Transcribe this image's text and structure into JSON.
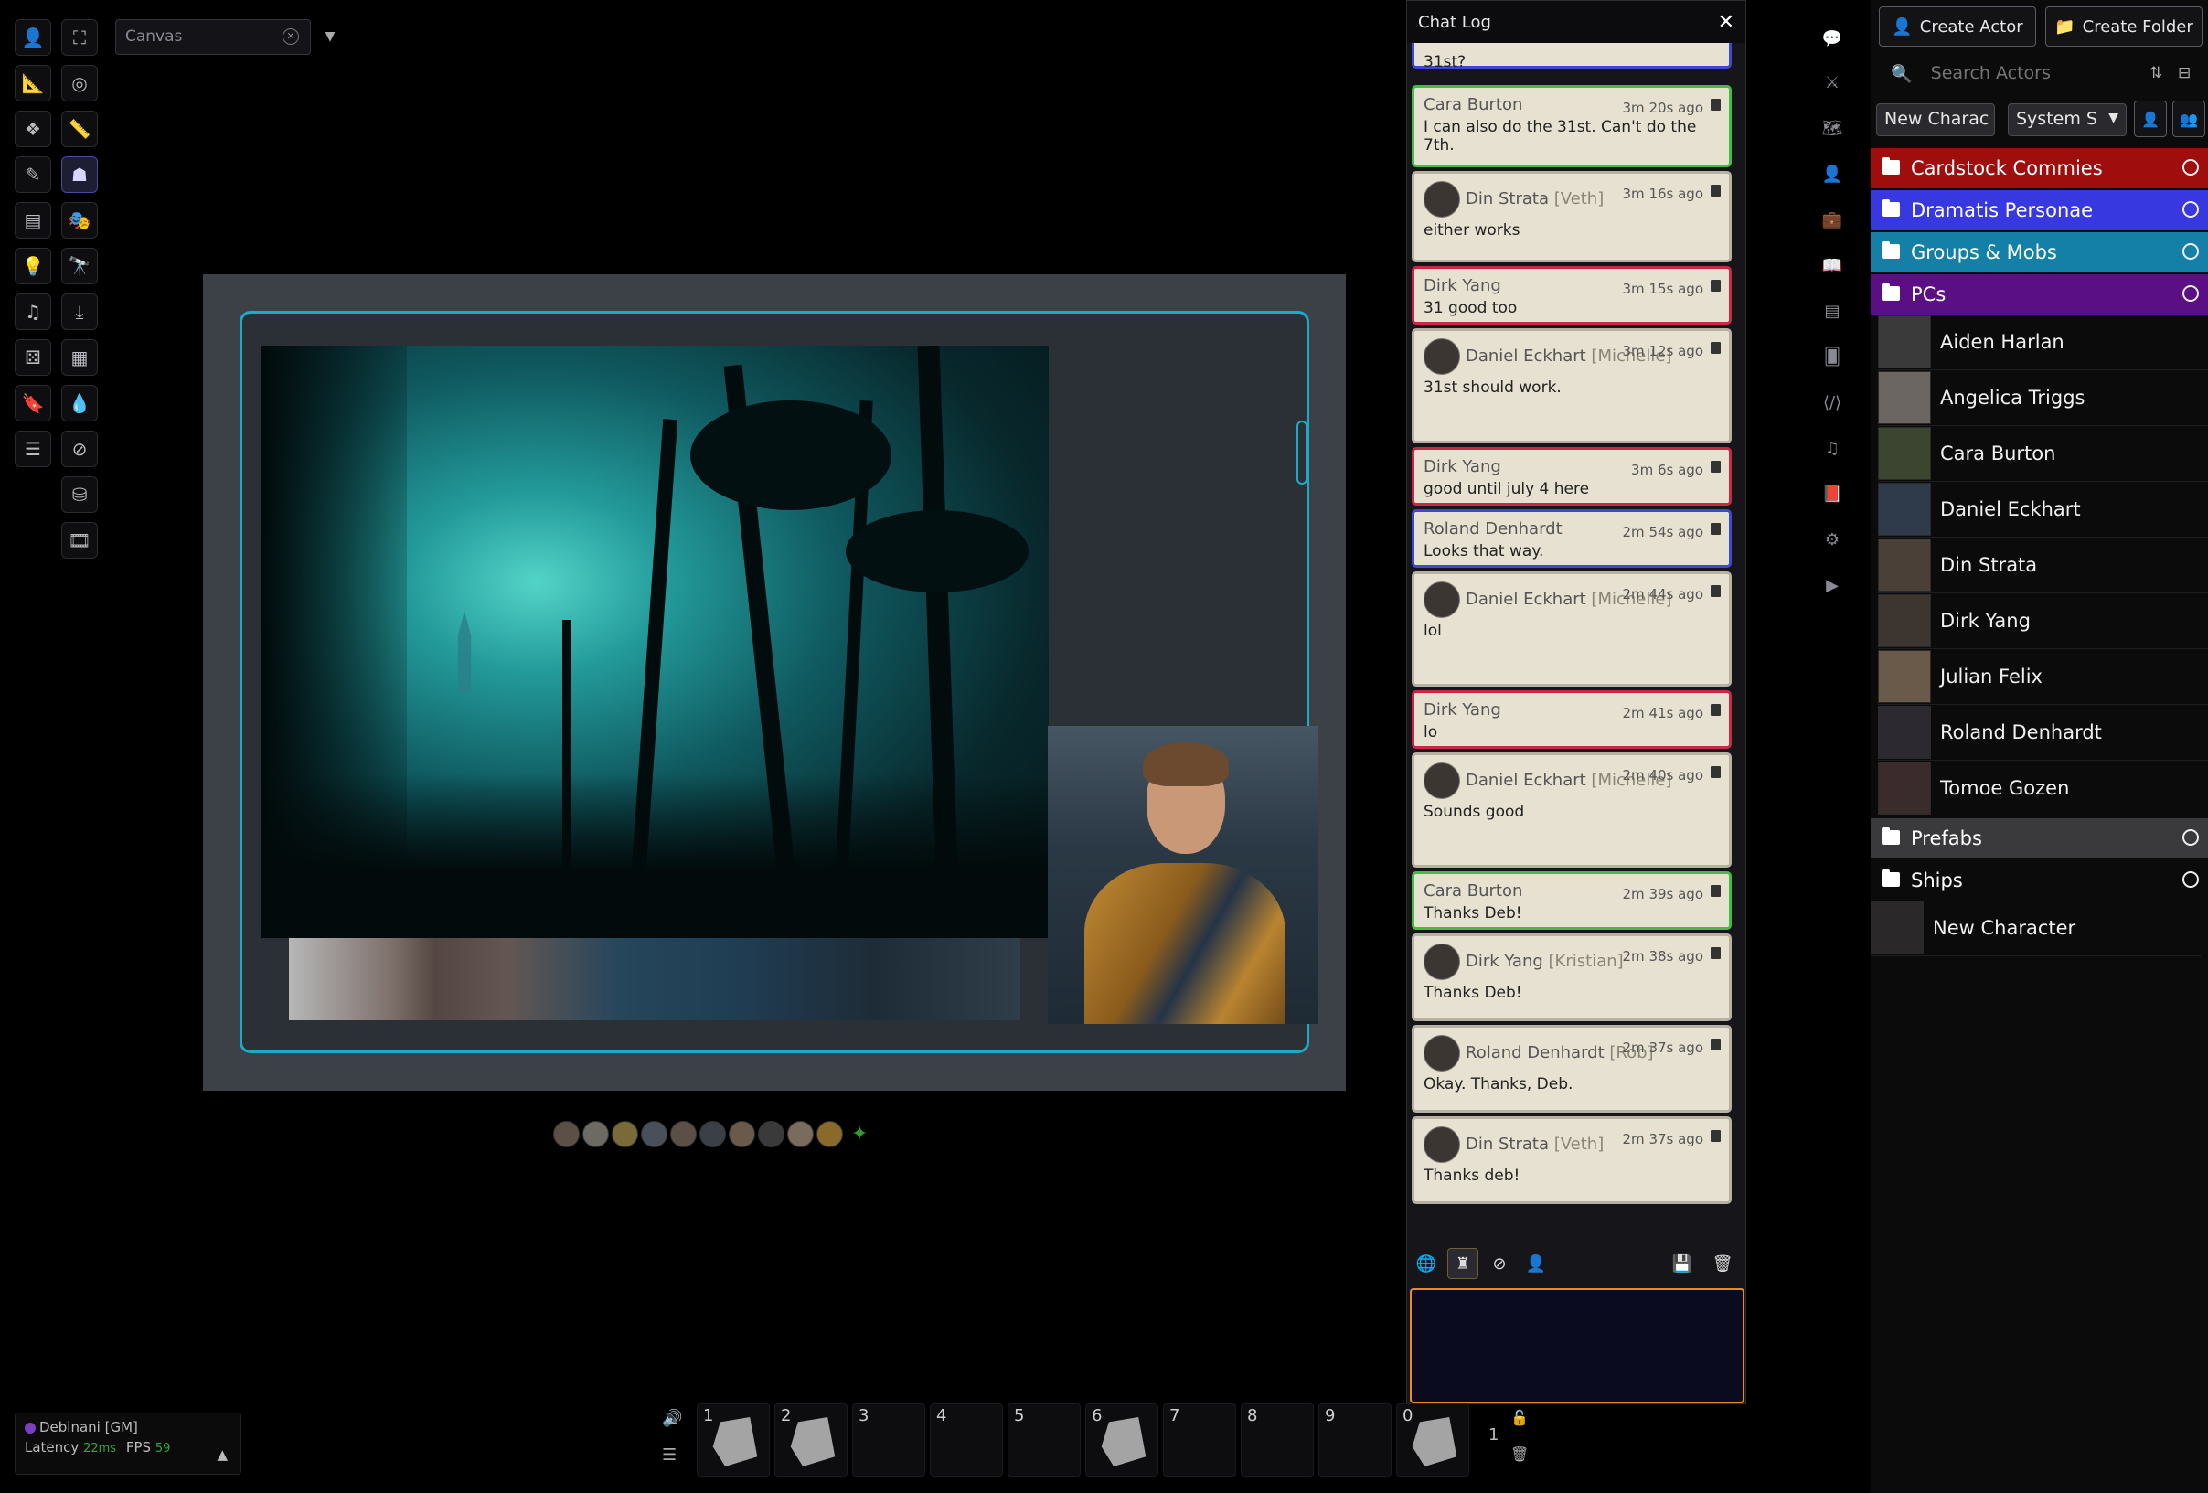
{
  "scene_nav": {
    "label": "Canvas"
  },
  "chat": {
    "title": "Chat Log",
    "partial_top": "31st?",
    "messages": [
      {
        "speaker": "Cara Burton",
        "alias": "",
        "time": "3m 20s ago",
        "text": "I can also do the 31st. Can't do the 7th.",
        "border": "green"
      },
      {
        "speaker": "Din Strata",
        "alias": "[Veth]",
        "time": "3m 16s ago",
        "text": "either works",
        "border": "grey"
      },
      {
        "speaker": "Dirk Yang",
        "alias": "",
        "time": "3m 15s ago",
        "text": "31 good too",
        "border": "red"
      },
      {
        "speaker": "Daniel Eckhart",
        "alias": "[Michelle]",
        "time": "3m 12s ago",
        "text": "31st should work.",
        "border": "grey"
      },
      {
        "speaker": "Dirk Yang",
        "alias": "",
        "time": "3m 6s ago",
        "text": "good until july 4 here",
        "border": "red"
      },
      {
        "speaker": "Roland Denhardt",
        "alias": "",
        "time": "2m 54s ago",
        "text": "Looks that way.",
        "border": "blue"
      },
      {
        "speaker": "Daniel Eckhart",
        "alias": "[Michelle]",
        "time": "2m 44s ago",
        "text": "lol",
        "border": "grey"
      },
      {
        "speaker": "Dirk Yang",
        "alias": "",
        "time": "2m 41s ago",
        "text": "lo",
        "border": "red"
      },
      {
        "speaker": "Daniel Eckhart",
        "alias": "[Michelle]",
        "time": "2m 40s ago",
        "text": "Sounds good",
        "border": "grey"
      },
      {
        "speaker": "Cara Burton",
        "alias": "",
        "time": "2m 39s ago",
        "text": "Thanks Deb!",
        "border": "green"
      },
      {
        "speaker": "Dirk Yang",
        "alias": "[Kristian]",
        "time": "2m 38s ago",
        "text": "Thanks Deb!",
        "border": "grey"
      },
      {
        "speaker": "Roland Denhardt",
        "alias": "[Rob]",
        "time": "2m 37s ago",
        "text": "Okay. Thanks, Deb.",
        "border": "grey"
      },
      {
        "speaker": "Din Strata",
        "alias": "[Veth]",
        "time": "2m 37s ago",
        "text": "Thanks deb!",
        "border": "grey"
      }
    ]
  },
  "actors": {
    "create_actor": "Create Actor",
    "create_folder": "Create Folder",
    "search_placeholder": "Search Actors",
    "new_character_select": "New Charac",
    "system_select": "System S",
    "folders": [
      {
        "name": "Cardstock Commies",
        "color": "#a00d0d"
      },
      {
        "name": "Dramatis Personae",
        "color": "#3838e0"
      },
      {
        "name": "Groups & Mobs",
        "color": "#1480a8"
      },
      {
        "name": "PCs",
        "color": "#5a0f84"
      }
    ],
    "pcs": [
      "Aiden Harlan",
      "Angelica Triggs",
      "Cara Burton",
      "Daniel Eckhart",
      "Din Strata",
      "Dirk Yang",
      "Julian Felix",
      "Roland Denhardt",
      "Tomoe Gozen"
    ],
    "bottom_folders": [
      {
        "name": "Prefabs",
        "color": "#3a3a3c"
      },
      {
        "name": "Ships",
        "color": "#0b0b0c"
      }
    ],
    "loose_actor": "New Character"
  },
  "players": {
    "user": "Debinani [GM]",
    "latency_label": "Latency",
    "latency": "22ms",
    "fps_label": "FPS",
    "fps": "59"
  },
  "hotbar": {
    "slots": [
      "1",
      "2",
      "3",
      "4",
      "5",
      "6",
      "7",
      "8",
      "9",
      "0"
    ],
    "page": "1"
  }
}
